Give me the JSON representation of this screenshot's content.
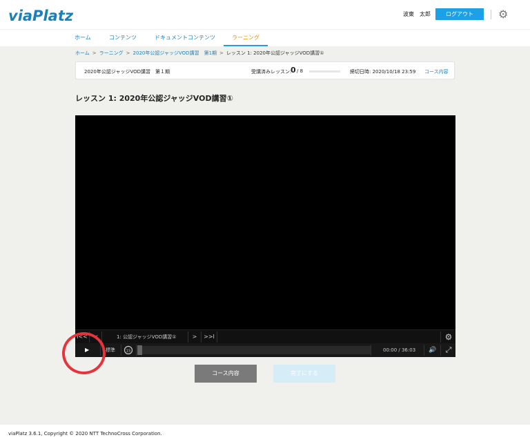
{
  "header": {
    "logo": "viaPlatz",
    "user_name": "波東　太郎",
    "logout": "ログアウト",
    "settings_icon": "gear-icon"
  },
  "nav": {
    "items": [
      {
        "label": "ホーム",
        "active": false
      },
      {
        "label": "コンテンツ",
        "active": false
      },
      {
        "label": "ドキュメントコンテンツ",
        "active": false
      },
      {
        "label": "ラーニング",
        "active": true
      }
    ],
    "active_color": "#f08c00",
    "link_color": "#1b7fb8"
  },
  "breadcrumb": {
    "items": [
      "ホーム",
      "ラーニング",
      "2020年公認ジャッジVOD講習　第1期",
      "レッスン 1: 2020年公認ジャッジVOD講習①"
    ],
    "separator": ">"
  },
  "course_info": {
    "course_name": "2020年公認ジャッジVOD講習　第１期",
    "completed_label": "受講済みレッスン:",
    "completed_count": "0",
    "total": "/ 8",
    "progress_fraction": 0,
    "deadline": "締切日時: 2020/10/18 23:59",
    "course_link": "コース内容"
  },
  "lesson": {
    "title": "レッスン 1: 2020年公認ジャッジVOD講習①"
  },
  "player": {
    "chapter_title": "1: 公認ジャッジVOD講習①",
    "speed": "標準",
    "time": "00:00 / 36:03",
    "rewind_label": "15",
    "icons": {
      "first": "skip-first-icon",
      "prev": "prev-icon",
      "next": "next-icon",
      "last": "skip-last-icon",
      "settings": "gear-icon",
      "play": "play-icon",
      "rewind": "rewind-15-icon",
      "volume": "volume-icon",
      "fullscreen": "fullscreen-icon"
    },
    "glyphs": {
      "first": "I<<",
      "prev": "<",
      "next": ">",
      "last": ">>I",
      "play": "▶",
      "volume": "🔊",
      "fullscreen": "⤢",
      "gear": "⚙"
    }
  },
  "actions": {
    "course_contents": "コース内容",
    "complete": "完了にする"
  },
  "footer": {
    "text": "viaPlatz 3.6.1, Copyright © 2020 NTT TechnoCross Corporation."
  },
  "colors": {
    "accent": "#1da1e6",
    "highlight": "#e5343b"
  }
}
